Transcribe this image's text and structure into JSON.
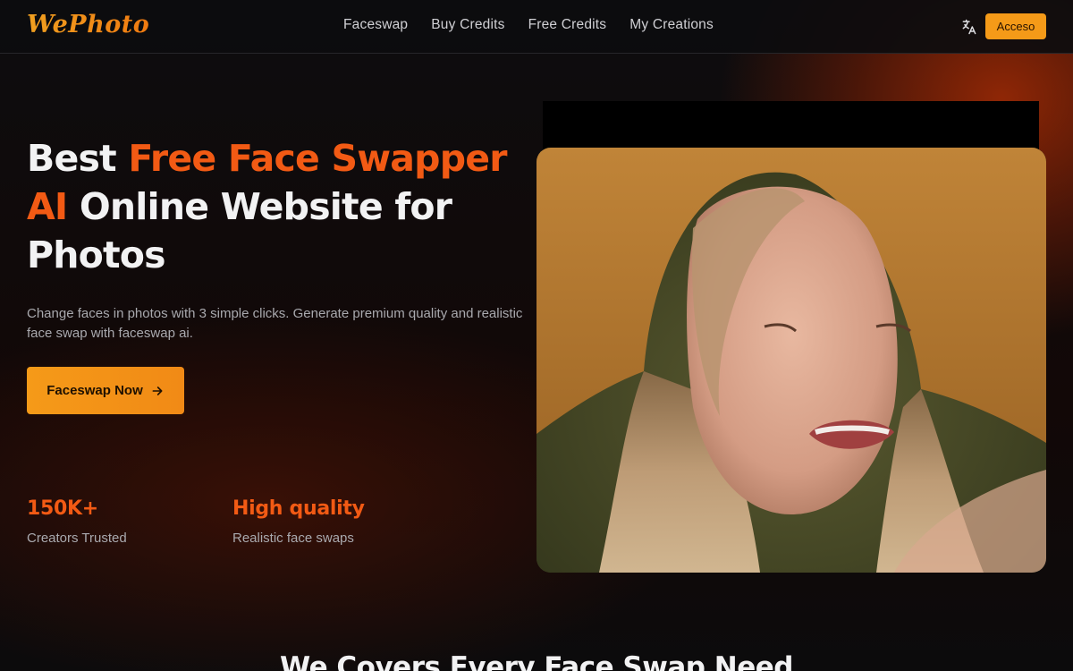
{
  "brand": {
    "logo": "WePhoto"
  },
  "nav": {
    "items": [
      {
        "label": "Faceswap"
      },
      {
        "label": "Buy Credits"
      },
      {
        "label": "Free Credits"
      },
      {
        "label": "My Creations"
      }
    ]
  },
  "header": {
    "login_label": "Acceso",
    "language_icon": "translate-icon"
  },
  "hero": {
    "title_part1": "Best ",
    "title_accent": "Free Face Swapper AI",
    "title_part2": " Online Website for Photos",
    "subtitle": "Change faces in photos with 3 simple clicks. Generate premium quality and realistic face swap with faceswap ai.",
    "cta_label": "Faceswap Now",
    "cta_icon": "arrow-right-icon"
  },
  "stats": [
    {
      "value": "150K+",
      "label": "Creators Trusted"
    },
    {
      "value": "High quality",
      "label": "Realistic face swaps"
    }
  ],
  "section": {
    "title": "We Covers Every Face Swap Need"
  },
  "colors": {
    "accent": "#f25a14",
    "button": "#f59a18",
    "background": "#0b0b0c"
  }
}
